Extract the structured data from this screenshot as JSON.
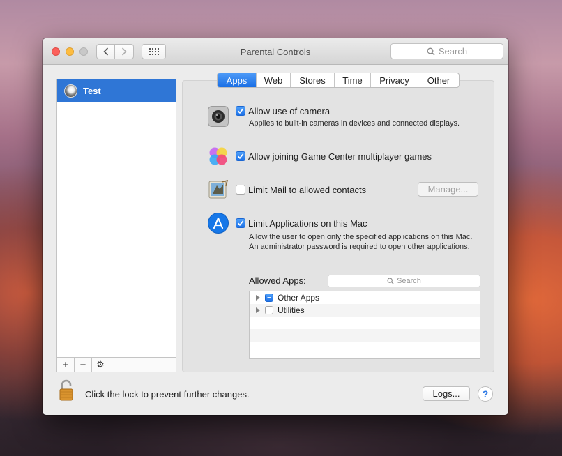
{
  "window": {
    "title": "Parental Controls",
    "search_placeholder": "Search"
  },
  "sidebar": {
    "users": [
      {
        "name": "Test"
      }
    ],
    "tools": {
      "add": "+",
      "remove": "−",
      "gear": "⚙"
    }
  },
  "tabs": [
    {
      "label": "Apps",
      "active": true
    },
    {
      "label": "Web"
    },
    {
      "label": "Stores"
    },
    {
      "label": "Time"
    },
    {
      "label": "Privacy"
    },
    {
      "label": "Other"
    }
  ],
  "options": {
    "camera": {
      "label": "Allow use of camera",
      "checked": true,
      "description": "Applies to built-in cameras in devices and connected displays."
    },
    "game_center": {
      "label": "Allow joining Game Center multiplayer games",
      "checked": true
    },
    "mail": {
      "label": "Limit Mail to allowed contacts",
      "checked": false,
      "button": "Manage..."
    },
    "apps": {
      "label": "Limit Applications on this Mac",
      "checked": true,
      "description": "Allow the user to open only the specified applications on this Mac. An administrator password is required to open other applications."
    }
  },
  "allowed_apps": {
    "label": "Allowed Apps:",
    "search_placeholder": "Search",
    "items": [
      {
        "name": "Other Apps",
        "state": "mixed"
      },
      {
        "name": "Utilities",
        "state": "unchecked"
      }
    ]
  },
  "footer": {
    "lock_text": "Click the lock to prevent further changes.",
    "logs_button": "Logs...",
    "help": "?"
  }
}
